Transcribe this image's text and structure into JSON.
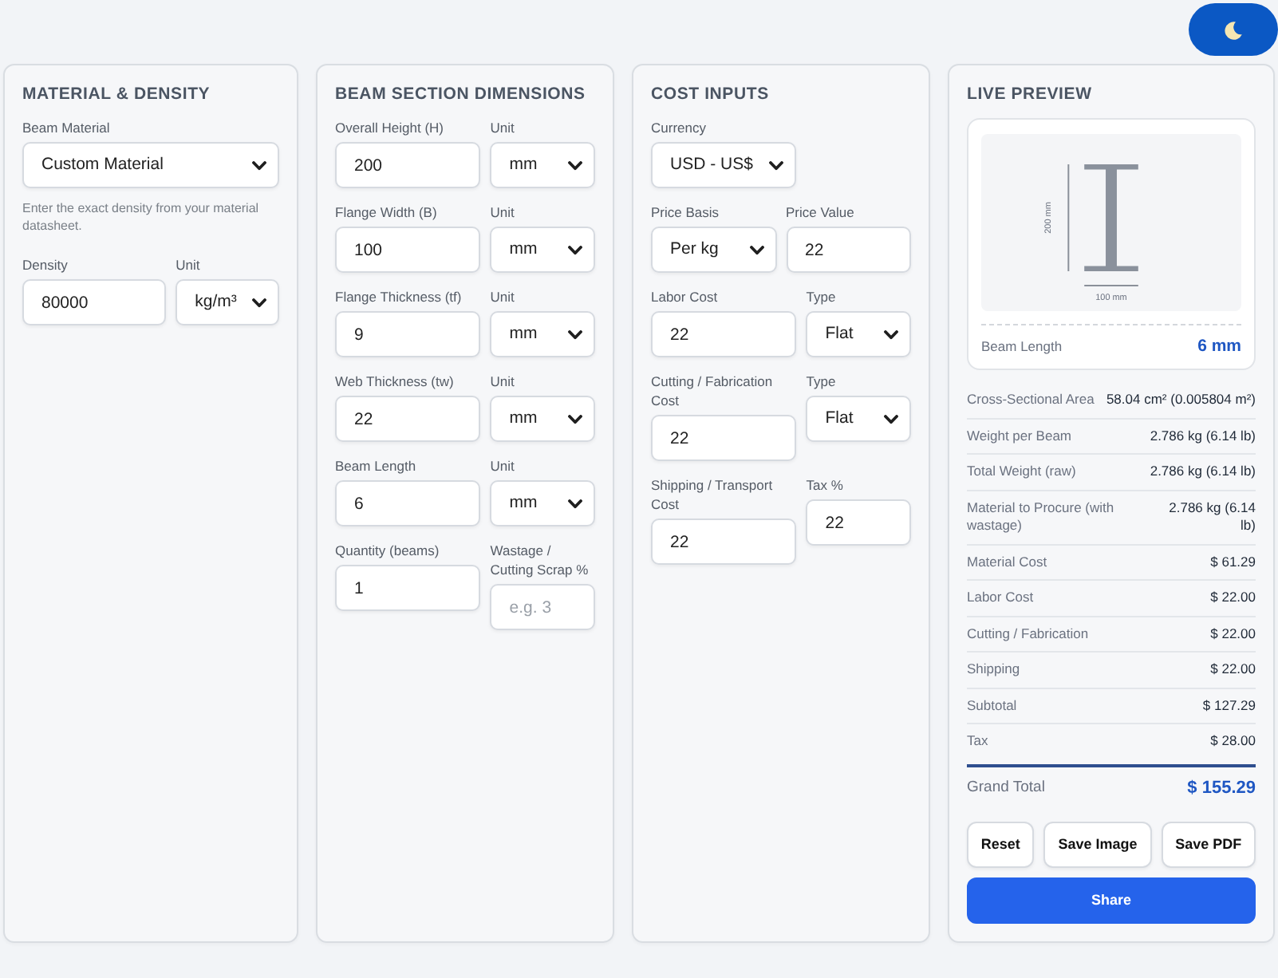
{
  "panels": [
    {
      "title": "MATERIAL & DENSITY",
      "rows": [
        {
          "kind": "fields",
          "fields": [
            {
              "kind": "select",
              "label": "Beam Material",
              "value": "Custom Material"
            }
          ]
        },
        {
          "kind": "note",
          "text": "Enter the exact density from your material datasheet."
        },
        {
          "kind": "fields",
          "fields": [
            {
              "kind": "input",
              "label": "Density",
              "value": "80000"
            },
            {
              "kind": "select",
              "label": "Unit",
              "value": "kg/m³"
            }
          ]
        }
      ]
    },
    {
      "title": "BEAM SECTION DIMENSIONS",
      "rows": [
        {
          "kind": "fields",
          "fields": [
            {
              "kind": "input",
              "label": "Overall Height (H)",
              "value": "200"
            },
            {
              "kind": "select",
              "label": "Unit",
              "value": "mm"
            }
          ]
        },
        {
          "kind": "fields",
          "fields": [
            {
              "kind": "input",
              "label": "Flange Width (B)",
              "value": "100"
            },
            {
              "kind": "select",
              "label": "Unit",
              "value": "mm"
            }
          ]
        },
        {
          "kind": "fields",
          "fields": [
            {
              "kind": "input",
              "label": "Flange Thickness (tf)",
              "value": "9"
            },
            {
              "kind": "select",
              "label": "Unit",
              "value": "mm"
            }
          ]
        },
        {
          "kind": "fields",
          "fields": [
            {
              "kind": "input",
              "label": "Web Thickness (tw)",
              "value": "22"
            },
            {
              "kind": "select",
              "label": "Unit",
              "value": "mm"
            }
          ]
        },
        {
          "kind": "fields",
          "fields": [
            {
              "kind": "input",
              "label": "Beam Length",
              "value": "6"
            },
            {
              "kind": "select",
              "label": "Unit",
              "value": "mm"
            }
          ]
        },
        {
          "kind": "fields",
          "fields": [
            {
              "kind": "input",
              "label": "Quantity (beams)",
              "value": "1"
            },
            {
              "kind": "input",
              "label": "Wastage / Cutting Scrap %",
              "placeholder": "e.g. 3"
            }
          ]
        }
      ]
    },
    {
      "title": "COST INPUTS",
      "rows": [
        {
          "kind": "fields",
          "fields": [
            {
              "kind": "select",
              "label": "Currency",
              "value": "USD - US$"
            }
          ]
        },
        {
          "kind": "fields",
          "fields": [
            {
              "kind": "select",
              "label": "Price Basis",
              "value": "Per kg"
            },
            {
              "kind": "input",
              "label": "Price Value",
              "value": "22"
            }
          ]
        },
        {
          "kind": "fields",
          "fields": [
            {
              "kind": "input",
              "label": "Labor Cost",
              "value": "22"
            },
            {
              "kind": "select",
              "label": "Type",
              "value": "Flat"
            }
          ]
        },
        {
          "kind": "fields",
          "fields": [
            {
              "kind": "input",
              "label": "Cutting / Fabrication Cost",
              "value": "22"
            },
            {
              "kind": "select",
              "label": "Type",
              "value": "Flat"
            }
          ]
        },
        {
          "kind": "fields",
          "fields": [
            {
              "kind": "input",
              "label": "Shipping / Transport Cost",
              "value": "22"
            },
            {
              "kind": "input",
              "label": "Tax %",
              "value": "22"
            }
          ]
        }
      ]
    }
  ],
  "preview": {
    "title": "LIVE PREVIEW",
    "height_label": "200 mm",
    "width_label": "100 mm",
    "length_label": "Beam Length",
    "length_value": "6 mm"
  },
  "results": [
    {
      "label": "Cross-Sectional Area",
      "value": "58.04 cm² (0.005804 m²)"
    },
    {
      "label": "Weight per Beam",
      "value": "2.786 kg (6.14 lb)"
    },
    {
      "label": "Total Weight (raw)",
      "value": "2.786 kg (6.14 lb)"
    },
    {
      "label": "Material to Procure (with wastage)",
      "value": "2.786 kg (6.14 lb)"
    },
    {
      "label": "Material Cost",
      "value": "$ 61.29"
    },
    {
      "label": "Labor Cost",
      "value": "$ 22.00"
    },
    {
      "label": "Cutting / Fabrication",
      "value": "$ 22.00"
    },
    {
      "label": "Shipping",
      "value": "$ 22.00"
    },
    {
      "label": "Subtotal",
      "value": "$ 127.29"
    },
    {
      "label": "Tax",
      "value": "$ 28.00"
    }
  ],
  "total": {
    "label": "Grand Total",
    "value": "$ 155.29"
  },
  "buttons": [
    {
      "label": "Reset",
      "kind": "outline"
    },
    {
      "label": "Save Image",
      "kind": "outline"
    },
    {
      "label": "Save PDF",
      "kind": "outline"
    },
    {
      "label": "Share",
      "kind": "primary"
    }
  ]
}
